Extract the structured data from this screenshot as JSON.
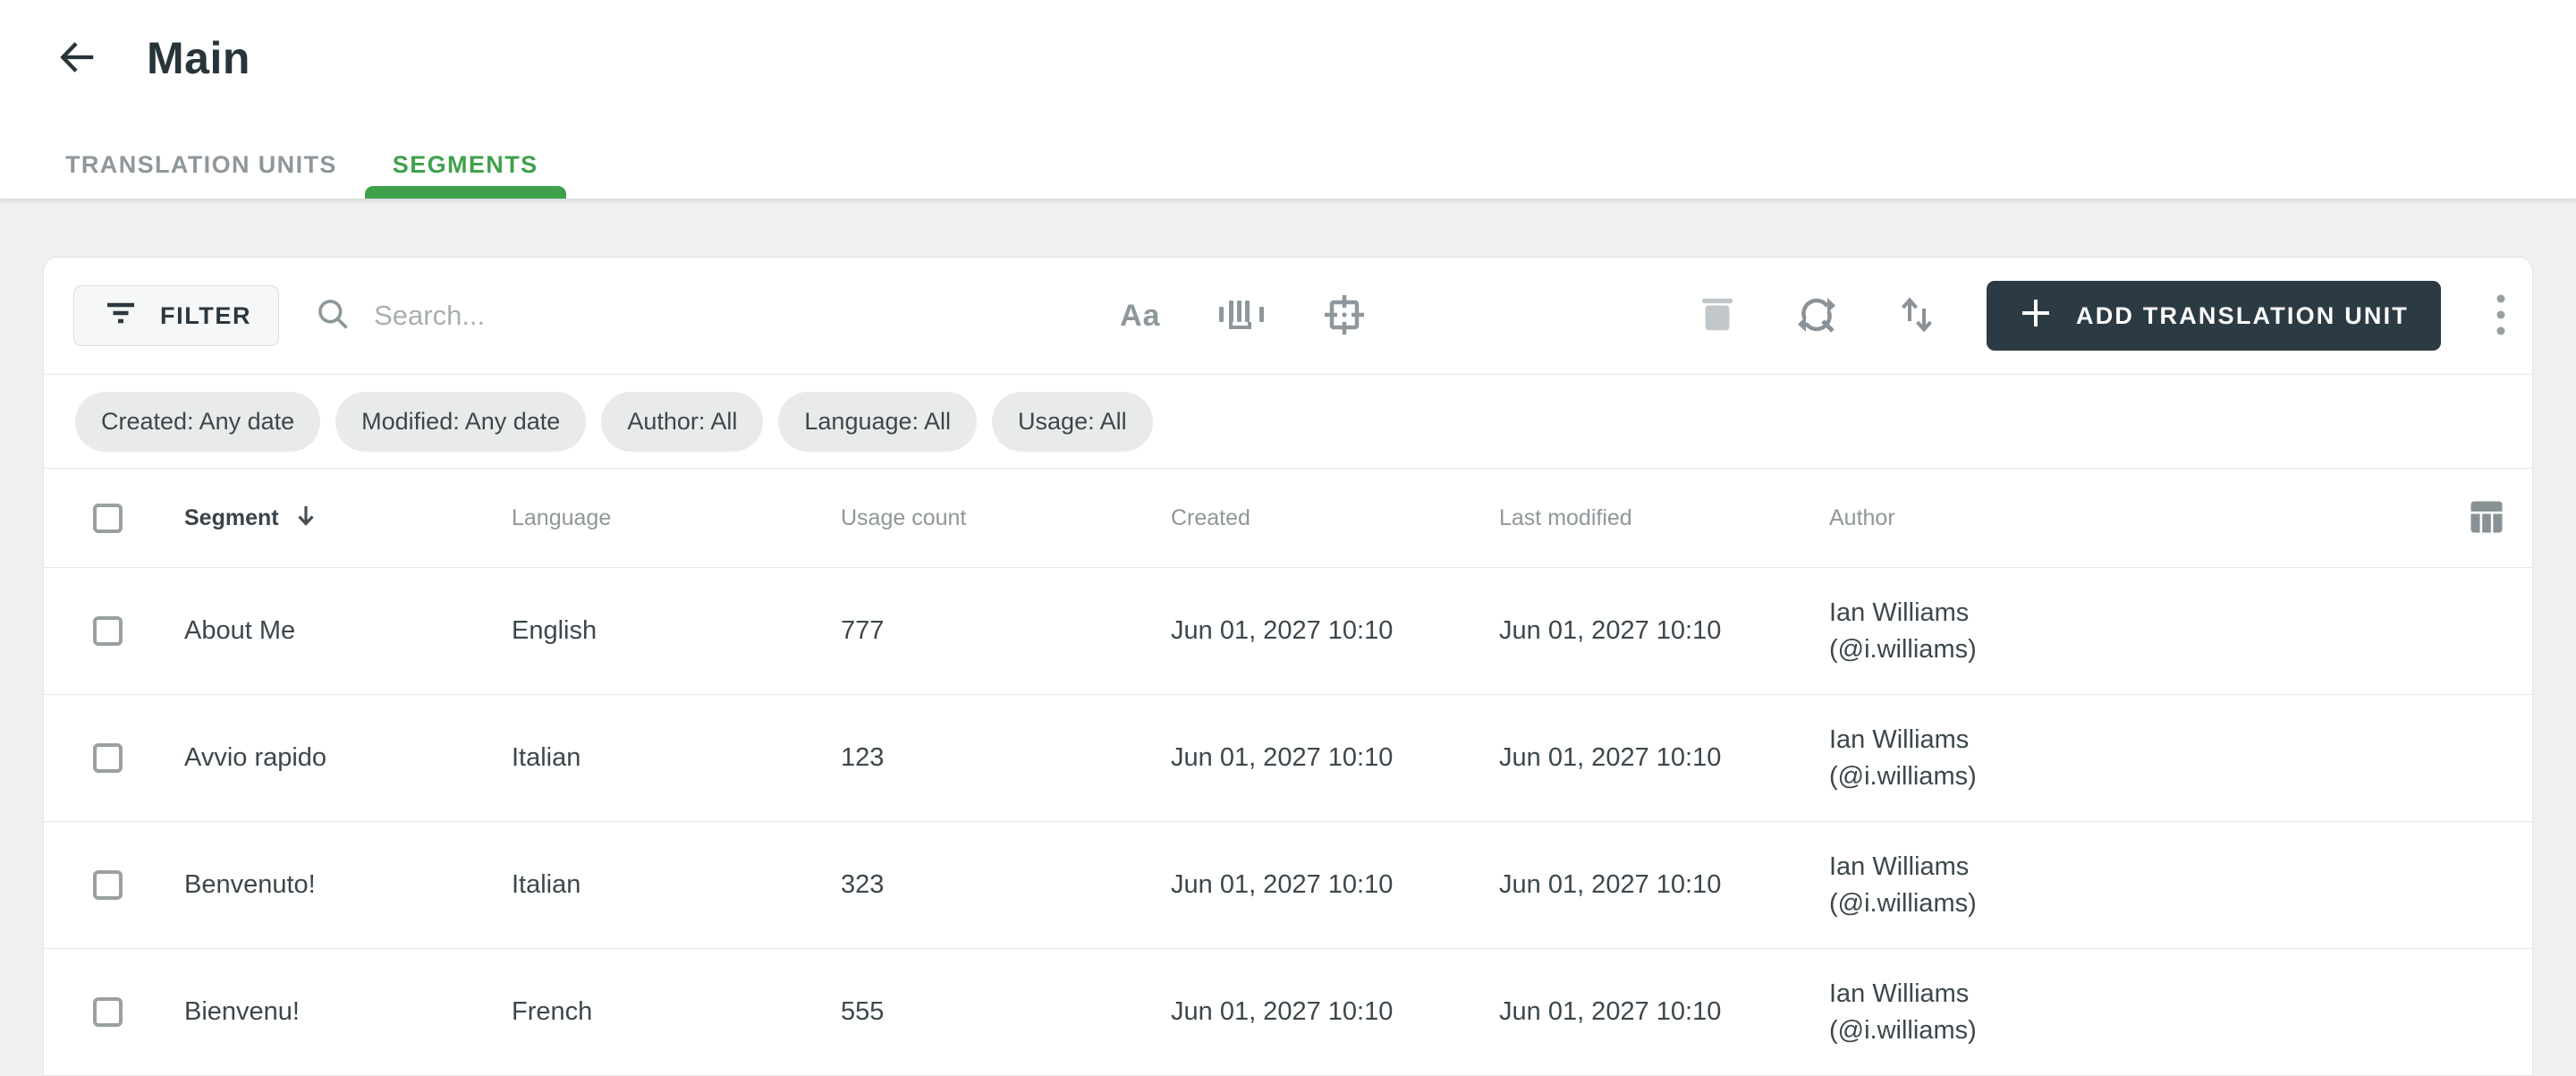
{
  "colors": {
    "accent_green": "#3fa14b",
    "button_dark": "#2c3a43"
  },
  "header": {
    "title": "Main"
  },
  "tabs": {
    "items": [
      {
        "label": "TRANSLATION UNITS",
        "active": false
      },
      {
        "label": "SEGMENTS",
        "active": true
      }
    ]
  },
  "toolbar": {
    "filter_label": "FILTER",
    "search_placeholder": "Search...",
    "match_case_glyph": "Aa",
    "add_button_label": "ADD TRANSLATION UNIT"
  },
  "filter_chips": [
    {
      "label": "Created: Any date"
    },
    {
      "label": "Modified: Any date"
    },
    {
      "label": "Author: All"
    },
    {
      "label": "Language: All"
    },
    {
      "label": "Usage: All"
    }
  ],
  "table": {
    "columns": {
      "segment": "Segment",
      "language": "Language",
      "usage_count": "Usage count",
      "created": "Created",
      "last_modified": "Last modified",
      "author": "Author"
    },
    "rows": [
      {
        "segment": "About Me",
        "language": "English",
        "usage_count": 777,
        "created": "Jun 01, 2027 10:10",
        "last_modified": "Jun 01, 2027 10:10",
        "author": "Ian Williams (@i.williams)"
      },
      {
        "segment": "Avvio rapido",
        "language": "Italian",
        "usage_count": 123,
        "created": "Jun 01, 2027 10:10",
        "last_modified": "Jun 01, 2027 10:10",
        "author": "Ian Williams (@i.williams)"
      },
      {
        "segment": "Benvenuto!",
        "language": "Italian",
        "usage_count": 323,
        "created": "Jun 01, 2027 10:10",
        "last_modified": "Jun 01, 2027 10:10",
        "author": "Ian Williams (@i.williams)"
      },
      {
        "segment": "Bienvenu!",
        "language": "French",
        "usage_count": 555,
        "created": "Jun 01, 2027 10:10",
        "last_modified": "Jun 01, 2027 10:10",
        "author": "Ian Williams (@i.williams)"
      }
    ]
  }
}
